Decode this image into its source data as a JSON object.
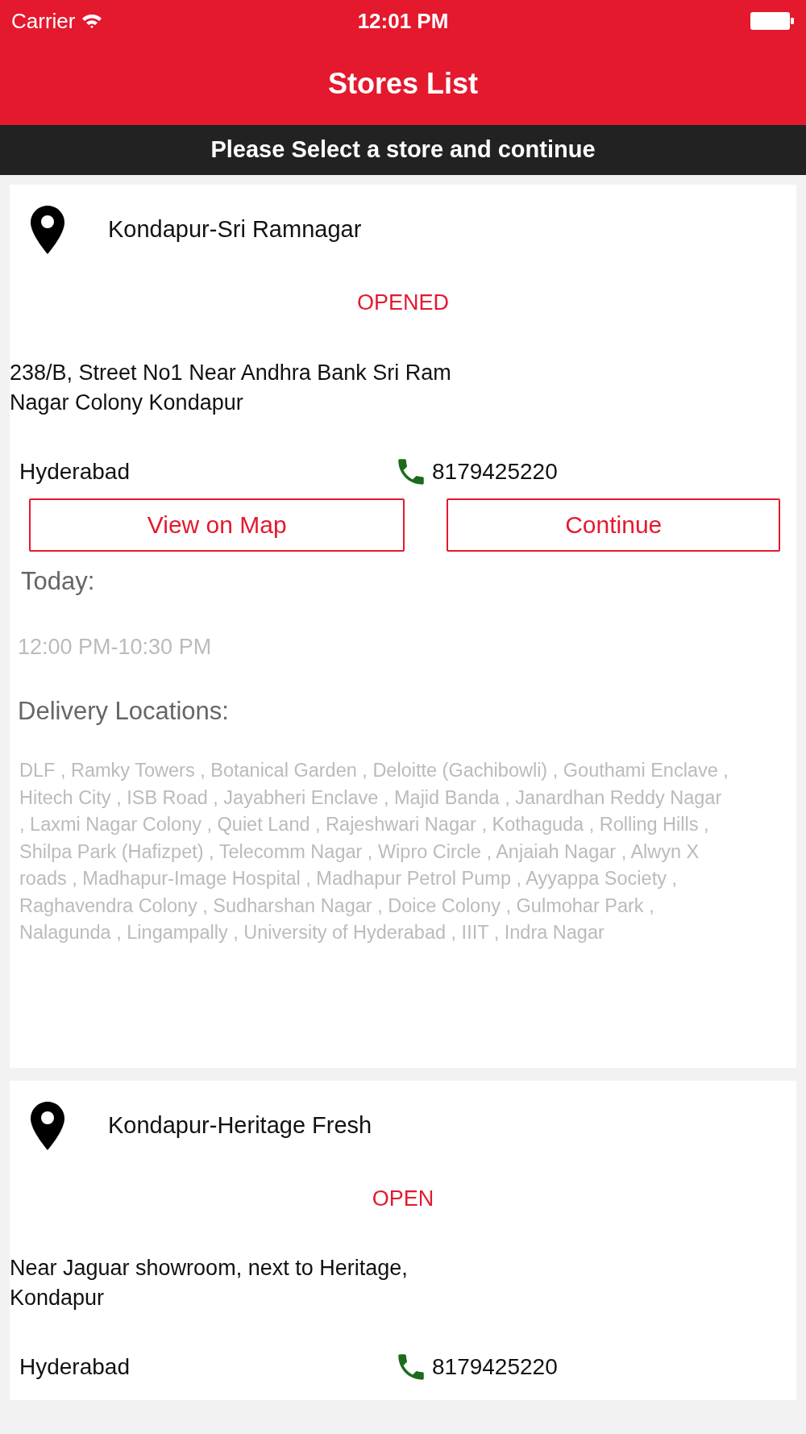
{
  "status_bar": {
    "carrier": "Carrier",
    "time": "12:01 PM"
  },
  "nav": {
    "title": "Stores List"
  },
  "banner": "Please Select a store and continue",
  "stores": [
    {
      "name": "Kondapur-Sri Ramnagar",
      "status": "OPENED",
      "address": "238/B, Street No1 Near Andhra Bank Sri Ram Nagar Colony Kondapur",
      "city": "Hyderabad",
      "phone": "8179425220",
      "buttons": [
        "View on Map",
        "Continue"
      ],
      "today_label": "Today:",
      "hours": "12:00 PM-10:30 PM",
      "delivery_label": "Delivery Locations:",
      "locations": "DLF , Ramky Towers , Botanical Garden , Deloitte (Gachibowli) , Gouthami Enclave , Hitech City , ISB Road , Jayabheri Enclave , Majid Banda , Janardhan Reddy Nagar , Laxmi Nagar Colony , Quiet Land , Rajeshwari Nagar , Kothaguda , Rolling Hills , Shilpa Park (Hafizpet) , Telecomm Nagar , Wipro Circle , Anjaiah Nagar , Alwyn X roads , Madhapur-Image Hospital , Madhapur Petrol Pump , Ayyappa Society , Raghavendra Colony , Sudharshan Nagar , Doice Colony , Gulmohar Park , Nalagunda , Lingampally , University of Hyderabad , IIIT , Indra Nagar"
    },
    {
      "name": "Kondapur-Heritage Fresh",
      "status": "OPEN",
      "address": "Near Jaguar showroom, next to Heritage, Kondapur",
      "city": "Hyderabad",
      "phone": "8179425220"
    }
  ]
}
